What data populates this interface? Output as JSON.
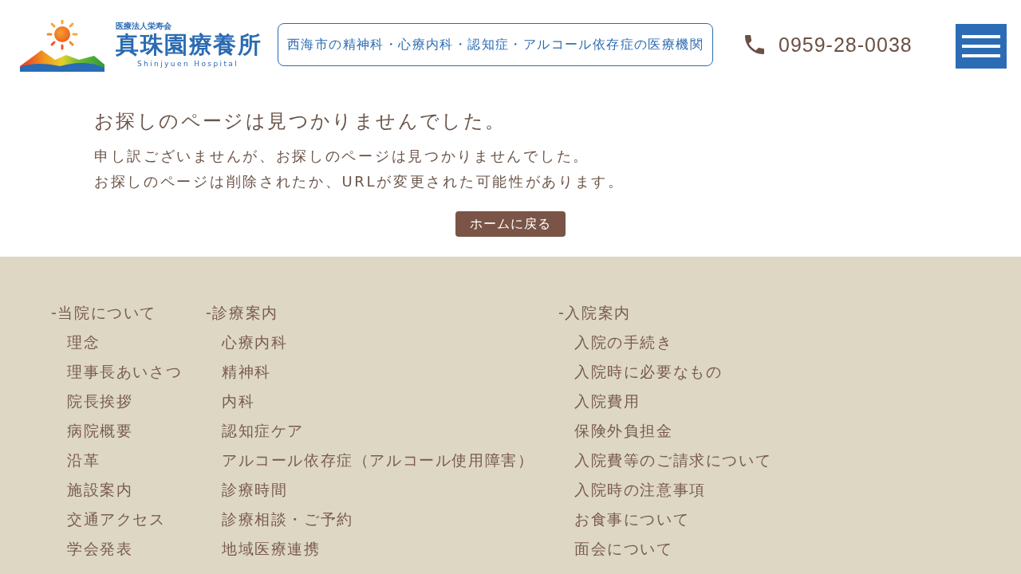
{
  "header": {
    "logo": {
      "corporation": "医療法人栄寿会",
      "name": "真珠園療養所",
      "name_en": "Shinjyuen Hospital"
    },
    "tagline": "西海市の精神科・心療内科・認知症・アルコール依存症の医療機関",
    "phone": "0959-28-0038"
  },
  "main": {
    "title": "お探しのページは見つかりませんでした。",
    "message": [
      "申し訳ございませんが、お探しのページは見つかりませんでした。",
      "お探しのページは削除されたか、URLが変更された可能性があります。"
    ],
    "home_button": "ホームに戻る"
  },
  "footer": {
    "columns": [
      {
        "heading": "-当院について",
        "items": [
          "理念",
          "理事長あいさつ",
          "院長挨拶",
          "病院概要",
          "沿革",
          "施設案内",
          "交通アクセス",
          "学会発表"
        ]
      },
      {
        "heading": "-診療案内",
        "items": [
          "心療内科",
          "精神科",
          "内科",
          "認知症ケア",
          "アルコール依存症（アルコール使用障害）",
          "診療時間",
          "診療相談・ご予約",
          "地域医療連携"
        ]
      },
      {
        "heading": "-入院案内",
        "items": [
          "入院の手続き",
          "入院時に必要なもの",
          "入院費用",
          "保険外負担金",
          "入院費等のご請求について",
          "入院時の注意事項",
          "お食事について",
          "面会について"
        ]
      }
    ]
  }
}
